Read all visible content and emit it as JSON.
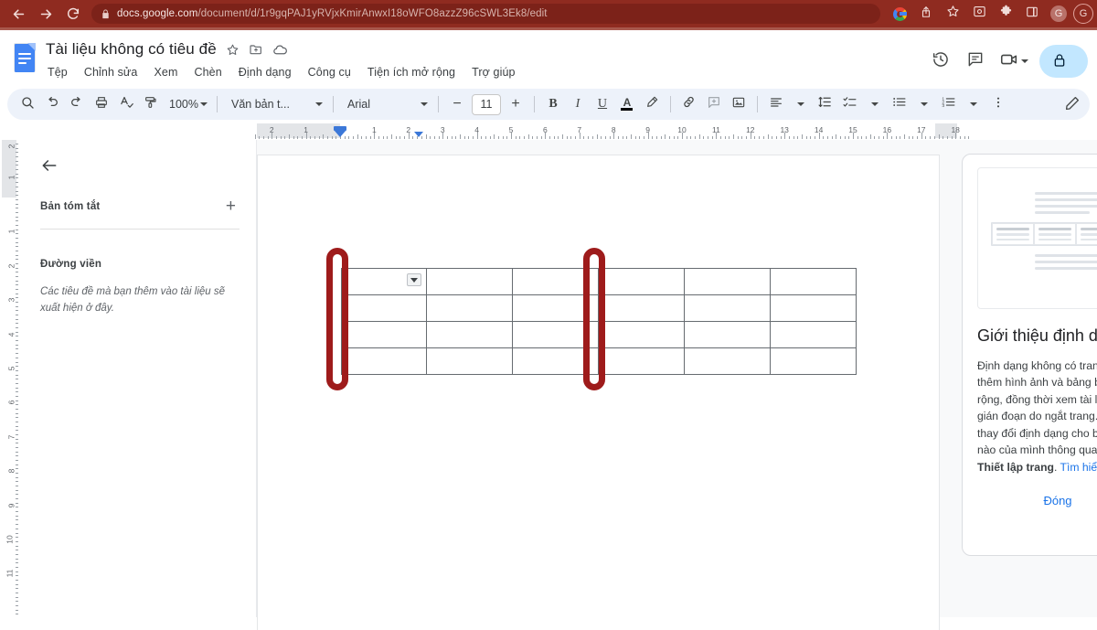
{
  "browser": {
    "url_prefix": "docs.google.com",
    "url_path": "/document/d/1r9gqPAJ1yRVjxKmirAnwxI18oWFO8azzZ96cSWL3Ek8/edit",
    "back_icon": "back-arrow-icon",
    "forward_icon": "forward-arrow-icon",
    "reload_icon": "reload-icon",
    "lock_icon": "lock-icon",
    "icons": [
      "google-logo-icon",
      "share-icon",
      "bookmark-star-icon",
      "screenshot-icon",
      "extensions-puzzle-icon",
      "side-panel-icon"
    ],
    "account_badge": "G",
    "profile_badge": "G"
  },
  "header": {
    "doc_title": "Tài liệu không có tiêu đề",
    "star_icon": "star-icon",
    "move_icon": "move-to-folder-icon",
    "cloud_icon": "cloud-saved-icon",
    "menus": [
      "Tệp",
      "Chỉnh sửa",
      "Xem",
      "Chèn",
      "Định dạng",
      "Công cụ",
      "Tiện ích mở rộng",
      "Trợ giúp"
    ],
    "history_icon": "version-history-icon",
    "comment_icon": "comment-icon",
    "meet_icon": "meet-camera-icon",
    "share_label": "",
    "share_icon": "lock-icon"
  },
  "toolbar": {
    "search_icon": "search-icon",
    "undo_icon": "undo-icon",
    "redo_icon": "redo-icon",
    "print_icon": "print-icon",
    "spellcheck_icon": "spellcheck-icon",
    "paint_format_icon": "paint-format-icon",
    "zoom_value": "100%",
    "style_value": "Văn bản t...",
    "font_value": "Arial",
    "font_size_value": "11",
    "decrease_font_label": "−",
    "increase_font_label": "+",
    "bold_label": "B",
    "italic_label": "I",
    "underline_label": "U",
    "text_color_label": "A",
    "text_color_hex": "#000000",
    "highlight_icon": "highlight-pen-icon",
    "link_icon": "insert-link-icon",
    "comment_icon": "add-comment-icon",
    "image_icon": "insert-image-icon",
    "align_icon": "align-left-icon",
    "line_spacing_icon": "line-spacing-icon",
    "checklist_icon": "checklist-icon",
    "bulleted_list_icon": "bulleted-list-icon",
    "numbered_list_icon": "numbered-list-icon",
    "more_icon": "more-options-icon",
    "edit_mode_icon": "pen-edit-icon"
  },
  "ruler": {
    "horizontal_labels": [
      "2",
      "1",
      "1",
      "2",
      "3",
      "4",
      "5",
      "6",
      "7",
      "8",
      "9",
      "10",
      "11",
      "12",
      "13",
      "14",
      "15",
      "16",
      "17",
      "18"
    ],
    "vertical_labels": [
      "2",
      "1",
      "1",
      "2",
      "3",
      "4",
      "5",
      "6",
      "7",
      "8",
      "9",
      "10",
      "11"
    ]
  },
  "outline": {
    "back_icon": "back-arrow-icon",
    "summary_label": "Bản tóm tắt",
    "add_icon": "add-summary-icon",
    "outline_label": "Đường viền",
    "empty_hint": "Các tiêu đề mà bạn thêm vào tài liệu sẽ xuất hiện ở đây."
  },
  "document": {
    "table": {
      "rows": 4,
      "cols": 6,
      "cells": [
        [
          "",
          "",
          "",
          "",
          "",
          ""
        ],
        [
          "",
          "",
          "",
          "",
          "",
          ""
        ],
        [
          "",
          "",
          "",
          "",
          "",
          ""
        ],
        [
          "",
          "",
          "",
          "",
          "",
          ""
        ]
      ],
      "cell_dropdown_icon": "cell-dropdown-icon",
      "caret": "text-cursor"
    },
    "annotations": [
      {
        "name": "left-column-border-highlight",
        "color": "#9e1b1b"
      },
      {
        "name": "middle-column-border-highlight",
        "color": "#9e1b1b"
      }
    ]
  },
  "promo": {
    "thumbnail_alt": "pageless-document-preview",
    "title": "Giới thiệu định dạng không có trang",
    "body_lines": [
      "Định dạng không có trang cho phép bạn",
      "thêm hình ảnh và bảng biểu có chiều",
      "rộng, đồng thời xem tài liệu mà không bị",
      "gián đoạn do ngắt trang. Bạn có thể",
      "thay đổi định dạng cho bất kỳ tài liệu",
      "nào của mình thông qua trình đơn"
    ],
    "body_bold": "Thiết lập trang",
    "body_link": "Tìm hiểu thêm",
    "close_label": "Đóng"
  }
}
